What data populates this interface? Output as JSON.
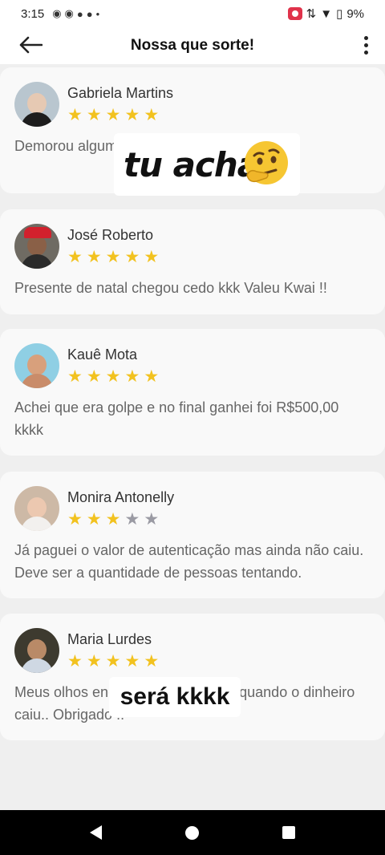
{
  "status_bar": {
    "time": "3:15",
    "battery": "9%"
  },
  "app_bar": {
    "title": "Nossa que sorte!"
  },
  "reviews": [
    {
      "name": "Gabriela Martins",
      "rating": 5,
      "text": "Demorou algum tempo, mas deu certo"
    },
    {
      "name": "José Roberto",
      "rating": 5,
      "text": "Presente de natal chegou cedo kkk Valeu Kwai !!"
    },
    {
      "name": "Kauê Mota",
      "rating": 5,
      "text": "Achei que era golpe e no final ganhei foi R$500,00 kkkk"
    },
    {
      "name": "Monira Antonelly",
      "rating": 3,
      "text": "Já paguei o valor de autenticação mas ainda não caiu. Deve ser a quantidade de pessoas tentando."
    },
    {
      "name": "Maria Lurdes",
      "rating": 5,
      "text": "Meus olhos encheram de lágrimas quando o dinheiro caiu.. Obrigado !!"
    }
  ],
  "overlays": {
    "top": "tu acha",
    "bottom": "será kkkk"
  },
  "colors": {
    "star_on": "#f2c21f",
    "star_off": "#9a9aa3",
    "card_bg": "#f9f9f9",
    "page_bg": "#efefef"
  }
}
